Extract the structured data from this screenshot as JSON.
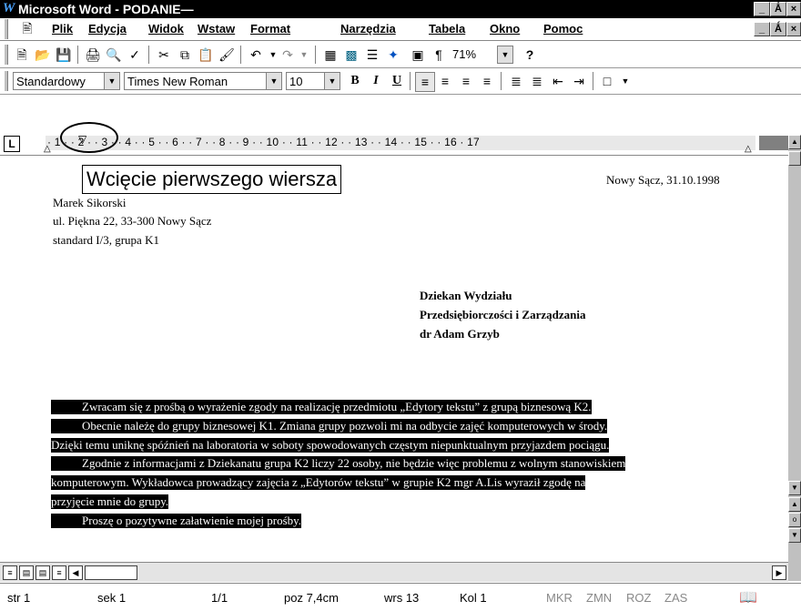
{
  "window": {
    "title": "Microsoft Word - PODANIE—",
    "logo": "W",
    "buttons": [
      "_",
      "Ǻ",
      "×"
    ]
  },
  "menu": {
    "icon": "document-icon",
    "items": [
      "Plik",
      "Edycja",
      "Widok",
      "Wstaw",
      "Format",
      "Narzędzia",
      "Tabela",
      "Okno",
      "Pomoc"
    ]
  },
  "toolbar_standard": {
    "zoom": "71%"
  },
  "toolbar_formatting": {
    "style": "Standardowy",
    "font": "Times New Roman",
    "size": "10",
    "bold": "B",
    "italic": "I",
    "underline": "U"
  },
  "ruler": {
    "text": "· 1 · · 2 · · 3 · · 4 · · 5 · · 6 · · 7 · · 8 · · 9 · · 10 · · 11 · · 12 · · 13 · · 14 · · 15 · · 16 · 17",
    "tab_marker": "L"
  },
  "tooltip": "Wcięcie pierwszego wiersza",
  "document": {
    "date": "Nowy Sącz, 31.10.1998",
    "sender": [
      "Marek Sikorski",
      "ul. Piękna 22, 33-300 Nowy Sącz",
      "standard I/3, grupa K1"
    ],
    "recipient": [
      "Dziekan Wydziału",
      "Przedsiębiorczości i Zarządzania",
      "dr Adam Grzyb"
    ],
    "body": [
      "Zwracam się z prośbą o wyrażenie zgody na realizację przedmiotu „Edytory tekstu” z grupą biznesową K2.",
      "Obecnie należę do grupy biznesowej K1. Zmiana grupy pozwoli mi na odbycie zajęć komputerowych w środy.",
      "Dzięki temu uniknę spóźnień na laboratoria w soboty spowodowanych częstym niepunktualnym przyjazdem pociągu.",
      "Zgodnie z informacjami z Dziekanatu grupa K2 liczy 22 osoby, nie będzie więc problemu z wolnym stanowiskiem",
      "komputerowym. Wykładowca prowadzący zajęcia z „Edytorów tekstu”  w grupie K2 mgr A.Lis wyraził zgodę na",
      "przyjęcie mnie do grupy.",
      "Proszę o pozytywne załatwienie mojej prośby."
    ]
  },
  "status": {
    "page": "str 1",
    "section": "sek 1",
    "pages": "1/1",
    "position": "poz 7,4cm",
    "line": "wrs 13",
    "column": "Kol 1",
    "rec": "MKR",
    "trk": "ZMN",
    "ext": "ROZ",
    "ovr": "ZAS"
  }
}
